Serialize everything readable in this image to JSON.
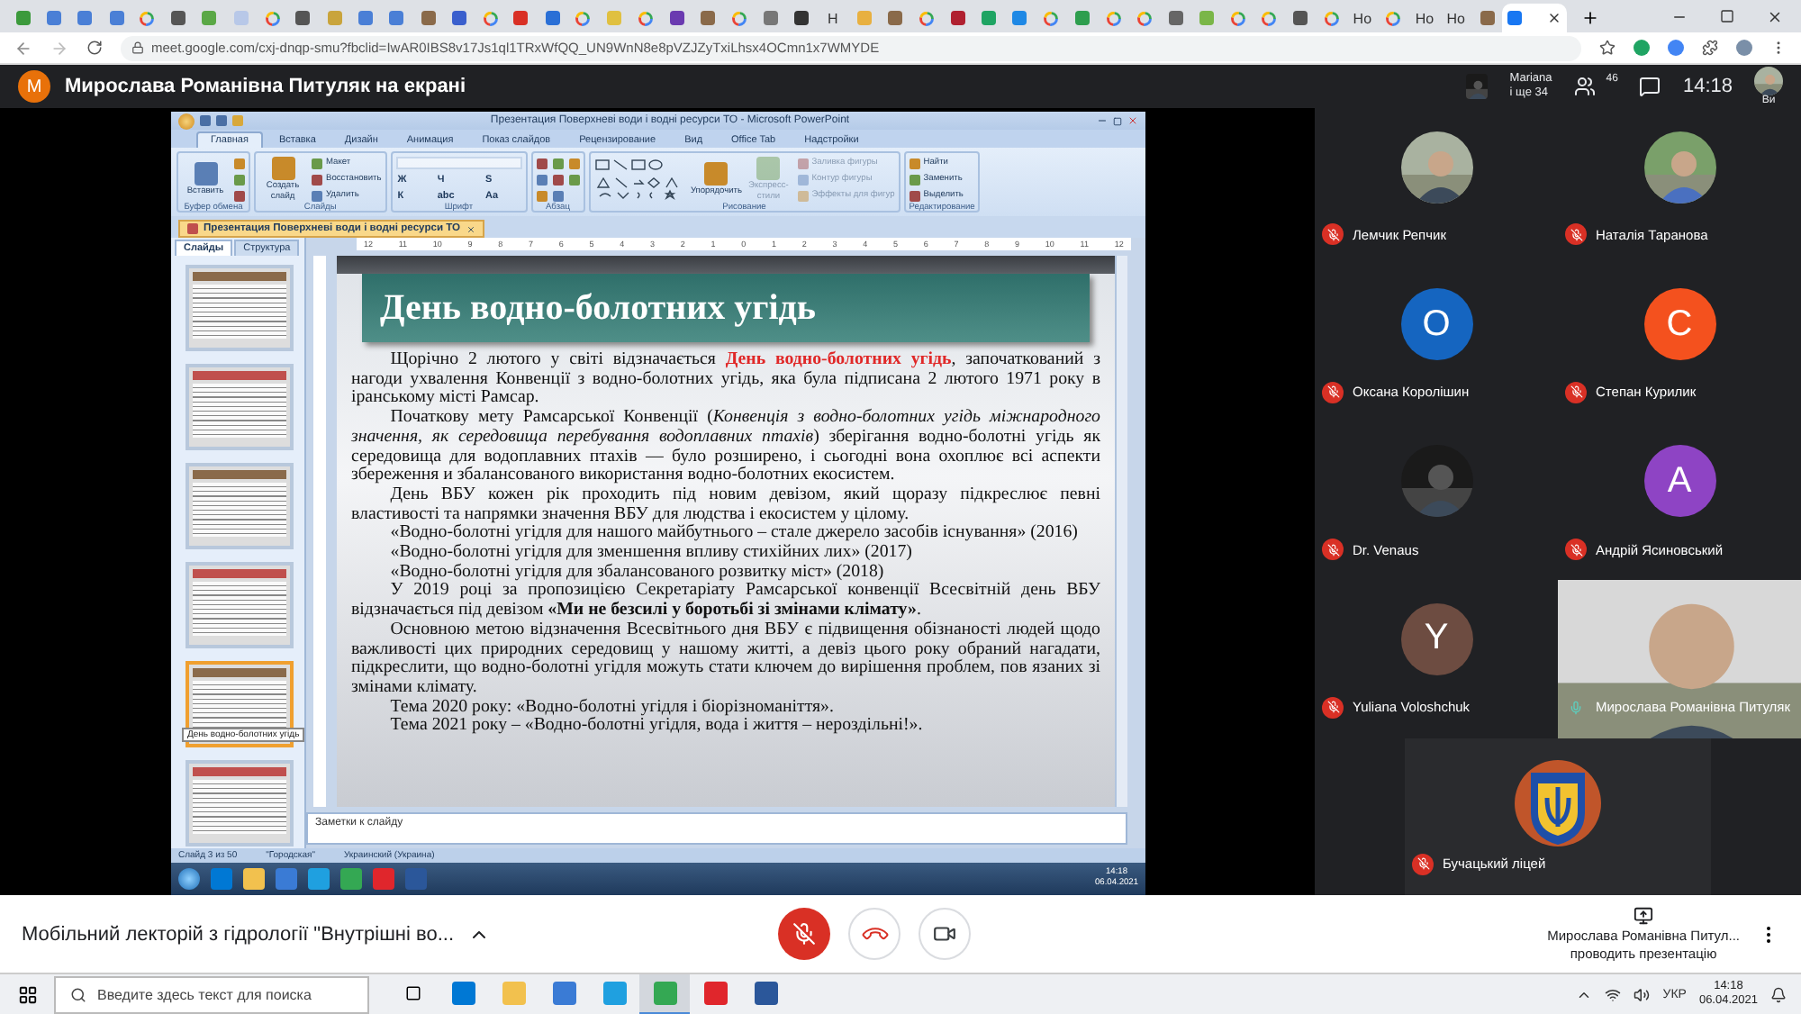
{
  "browser": {
    "tabs": [
      {
        "kind": "favicon",
        "color": "#3c9a3c",
        "selected": false
      },
      {
        "kind": "favicon",
        "color": "#4a7fd6",
        "selected": false
      },
      {
        "kind": "favicon",
        "color": "#4a7fd6",
        "selected": false
      },
      {
        "kind": "favicon",
        "color": "#4a7fd6",
        "selected": false
      },
      {
        "kind": "google",
        "selected": false
      },
      {
        "kind": "favicon",
        "color": "#555555",
        "selected": false
      },
      {
        "kind": "favicon",
        "color": "#5aa846",
        "selected": false
      },
      {
        "kind": "favicon",
        "color": "#b8c8e8",
        "selected": false
      },
      {
        "kind": "google",
        "selected": false
      },
      {
        "kind": "favicon",
        "color": "#555555",
        "selected": false
      },
      {
        "kind": "favicon",
        "color": "#c9a43c",
        "selected": false
      },
      {
        "kind": "favicon",
        "color": "#4a7fd6",
        "selected": false
      },
      {
        "kind": "favicon",
        "color": "#4a7fd6",
        "selected": false
      },
      {
        "kind": "favicon",
        "color": "#8a6a4a",
        "selected": false
      },
      {
        "kind": "favicon",
        "color": "#3a5fcd",
        "selected": false
      },
      {
        "kind": "google",
        "selected": false
      },
      {
        "kind": "favicon",
        "color": "#d93025",
        "selected": false
      },
      {
        "kind": "favicon",
        "color": "#2a6fd6",
        "selected": false
      },
      {
        "kind": "google",
        "selected": false
      },
      {
        "kind": "favicon",
        "color": "#e0c040",
        "selected": false
      },
      {
        "kind": "google",
        "selected": false
      },
      {
        "kind": "favicon",
        "color": "#6a3ab0",
        "selected": false
      },
      {
        "kind": "favicon",
        "color": "#8a6a4a",
        "selected": false
      },
      {
        "kind": "google",
        "selected": false
      },
      {
        "kind": "favicon",
        "color": "#777777",
        "selected": false
      },
      {
        "kind": "favicon",
        "color": "#333333",
        "selected": false
      },
      {
        "kind": "text",
        "label": "H",
        "selected": false
      },
      {
        "kind": "favicon",
        "color": "#e8b040",
        "selected": false
      },
      {
        "kind": "favicon",
        "color": "#8a6a4a",
        "selected": false
      },
      {
        "kind": "google",
        "selected": false
      },
      {
        "kind": "favicon",
        "color": "#b02030",
        "selected": false
      },
      {
        "kind": "favicon",
        "color": "#1fa463",
        "selected": false
      },
      {
        "kind": "favicon",
        "color": "#1e88e5",
        "selected": false
      },
      {
        "kind": "google",
        "selected": false
      },
      {
        "kind": "favicon",
        "color": "#2e9e4e",
        "selected": false
      },
      {
        "kind": "google",
        "selected": false
      },
      {
        "kind": "google",
        "selected": false
      },
      {
        "kind": "favicon",
        "color": "#666666",
        "selected": false
      },
      {
        "kind": "favicon",
        "color": "#7ab648",
        "selected": false
      },
      {
        "kind": "google",
        "selected": false
      },
      {
        "kind": "google",
        "selected": false
      },
      {
        "kind": "favicon",
        "color": "#555555",
        "selected": false
      },
      {
        "kind": "google",
        "selected": false
      },
      {
        "kind": "text",
        "label": "Ho",
        "selected": false
      },
      {
        "kind": "google",
        "selected": false
      },
      {
        "kind": "text",
        "label": "Ho",
        "selected": false
      },
      {
        "kind": "text",
        "label": "Ho",
        "selected": false
      },
      {
        "kind": "favicon",
        "color": "#8a6a4a",
        "selected": false
      },
      {
        "kind": "favicon",
        "color": "#1877f2",
        "selected": true
      }
    ],
    "address": "meet.google.com/cxj-dnqp-smu?fbclid=IwAR0IBS8v17Js1ql1TRxWfQQ_UN9WnN8e8pVZJZyTxiLhsx4OCmn1x7WMYDE"
  },
  "meet": {
    "initial": "M",
    "banner": "Мирослава Романівна Питуляк на екрані",
    "others_name": "Mariana",
    "others_more": "і ще 34",
    "people_count": "46",
    "time": "14:18",
    "self_label": "Ви"
  },
  "presentation": {
    "title": "Презентация Поверхневі води і водні ресурси ТО - Microsoft PowerPoint",
    "ribbon_tabs": [
      {
        "label": "Главная",
        "selected": true
      },
      {
        "label": "Вставка",
        "selected": false
      },
      {
        "label": "Дизайн",
        "selected": false
      },
      {
        "label": "Анимация",
        "selected": false
      },
      {
        "label": "Показ слайдов",
        "selected": false
      },
      {
        "label": "Рецензирование",
        "selected": false
      },
      {
        "label": "Вид",
        "selected": false
      },
      {
        "label": "Office Tab",
        "selected": false
      },
      {
        "label": "Надстройки",
        "selected": false
      }
    ],
    "ribbon_groups": [
      {
        "label": "Буфер обмена",
        "items": [
          {
            "kind": "large",
            "label": "Вставить",
            "disabled": false
          },
          {
            "kind": "icon",
            "disabled": false
          },
          {
            "kind": "icon",
            "disabled": false
          },
          {
            "kind": "icon",
            "disabled": false
          }
        ]
      },
      {
        "label": "Слайды",
        "items": [
          {
            "kind": "large",
            "label": "Создать слайд",
            "disabled": false
          },
          {
            "kind": "small",
            "label": "Макет",
            "disabled": false
          },
          {
            "kind": "small",
            "label": "Восстановить",
            "disabled": false
          },
          {
            "kind": "small",
            "label": "Удалить",
            "disabled": false
          }
        ]
      },
      {
        "label": "Шрифт",
        "items": [
          {
            "kind": "combo",
            "disabled": true
          },
          {
            "kind": "glyph",
            "label": "Ж",
            "disabled": false
          },
          {
            "kind": "glyph",
            "label": "К",
            "disabled": false
          },
          {
            "kind": "glyph",
            "label": "Ч",
            "disabled": false
          },
          {
            "kind": "glyph",
            "label": "abc",
            "disabled": false
          },
          {
            "kind": "glyph",
            "label": "S",
            "disabled": false
          },
          {
            "kind": "glyph",
            "label": "Aa",
            "disabled": false
          }
        ]
      },
      {
        "label": "Абзац",
        "items": [
          {
            "kind": "icon",
            "disabled": false
          },
          {
            "kind": "icon",
            "disabled": false
          },
          {
            "kind": "icon",
            "disabled": false
          },
          {
            "kind": "icon",
            "disabled": false
          },
          {
            "kind": "icon",
            "disabled": false
          },
          {
            "kind": "icon",
            "disabled": false
          },
          {
            "kind": "icon",
            "disabled": false
          },
          {
            "kind": "icon",
            "disabled": false
          }
        ]
      },
      {
        "label": "Рисование",
        "items": [
          {
            "kind": "shapes",
            "disabled": false
          },
          {
            "kind": "large",
            "label": "Упорядочить",
            "disabled": false
          },
          {
            "kind": "large",
            "label": "Экспресс-стили",
            "disabled": true
          },
          {
            "kind": "small",
            "label": "Заливка фигуры",
            "disabled": true
          },
          {
            "kind": "small",
            "label": "Контур фигуры",
            "disabled": true
          },
          {
            "kind": "small",
            "label": "Эффекты для фигур",
            "disabled": true
          }
        ]
      },
      {
        "label": "Редактирование",
        "items": [
          {
            "kind": "small",
            "label": "Найти",
            "disabled": false
          },
          {
            "kind": "small",
            "label": "Заменить",
            "disabled": false
          },
          {
            "kind": "small",
            "label": "Выделить",
            "disabled": false
          }
        ]
      }
    ],
    "document_tab": "Презентация Поверхневі води і водні ресурси ТО",
    "panel_tabs": [
      {
        "label": "Слайды",
        "selected": true
      },
      {
        "label": "Структура",
        "selected": false
      }
    ],
    "thumbnails": [
      {
        "selected": false
      },
      {
        "selected": false
      },
      {
        "selected": false
      },
      {
        "selected": false
      },
      {
        "selected": true
      },
      {
        "selected": false
      }
    ],
    "tooltip": "День водно-болотних угідь",
    "ruler": [
      "12",
      "11",
      "10",
      "9",
      "8",
      "7",
      "6",
      "5",
      "4",
      "3",
      "2",
      "1",
      "0",
      "1",
      "2",
      "3",
      "4",
      "5",
      "6",
      "7",
      "8",
      "9",
      "10",
      "11",
      "12"
    ],
    "slide": {
      "title": "День водно-болотних угідь",
      "paragraphs": [
        {
          "runs": [
            {
              "kind": "plain",
              "text": "Щорічно 2 лютого у світі відзначається "
            },
            {
              "kind": "highlight",
              "text": "День водно-болотних угідь"
            },
            {
              "kind": "plain",
              "text": ", започаткований з нагоди ухвалення Конвенції з водно-болотних угідь, яка була підписана 2 лютого 1971 року в іранському місті Рамсар."
            }
          ]
        },
        {
          "runs": [
            {
              "kind": "plain",
              "text": "Початкову мету Рамсарської Конвенції ("
            },
            {
              "kind": "italic",
              "text": "Конвенція з водно-болотних угідь міжнародного значення, як середовища перебування водоплавних птахів"
            },
            {
              "kind": "plain",
              "text": ") зберігання водно-болотні угідь як середовища для водоплавних птахів — було розширено, і сьогодні вона охоплює всі аспекти збереження и збалансованого використання водно-болотних екосистем."
            }
          ]
        },
        {
          "runs": [
            {
              "kind": "plain",
              "text": "День ВБУ кожен рік проходить під новим девізом, який щоразу підкреслює певні властивості та напрямки значення ВБУ для людства і екосистем у цілому."
            }
          ]
        },
        {
          "runs": [
            {
              "kind": "plain",
              "text": "«Водно-болотні угідля для нашого майбутнього – стале джерело засобів існування» (2016)"
            }
          ]
        },
        {
          "runs": [
            {
              "kind": "plain",
              "text": "«Водно-болотні угідля для зменшення впливу стихійних лих» (2017)"
            }
          ]
        },
        {
          "runs": [
            {
              "kind": "plain",
              "text": "«Водно-болотні угідля для збалансованого розвитку міст» (2018)"
            }
          ]
        },
        {
          "runs": [
            {
              "kind": "plain",
              "text": "У 2019 році за пропозицією Секретаріату Рамсарської конвенції Всесвітній день ВБУ відзначається під девізом "
            },
            {
              "kind": "bold",
              "text": "«Ми не безсилі у боротьбі зі змінами клімату»"
            },
            {
              "kind": "plain",
              "text": "."
            }
          ]
        },
        {
          "runs": [
            {
              "kind": "plain",
              "text": "Основною метою відзначення Всесвітнього дня ВБУ є підвищення обізнаності людей щодо важливості цих природних середовищ у нашому житті, а девіз цього року обраний нагадати, підкреслити, що водно-болотні угідля можуть стати ключем до вирішення проблем, пов язаних зі змінами клімату."
            }
          ]
        },
        {
          "runs": [
            {
              "kind": "plain",
              "text": "Тема  2020 року: «Водно-болотні угідля і біорізноманіття»."
            }
          ]
        },
        {
          "runs": [
            {
              "kind": "plain",
              "text": "Тема 2021 року – «Водно-болотні угідля, вода і життя – нероздільні!»."
            }
          ]
        }
      ]
    },
    "notes_placeholder": "Заметки к слайду",
    "status": [
      "Слайд 3 из 50",
      "\"Городская\"",
      "Украинский (Украина)"
    ],
    "inner_taskbar": {
      "time": "14:18",
      "date": "06.04.2021"
    }
  },
  "participants": [
    {
      "name": "Лемчик Репчик",
      "muted": true
    },
    {
      "name": "Наталія Таранова",
      "muted": true
    },
    {
      "kind": "letter",
      "letter": "O",
      "color": "#1565c0",
      "name": "Оксана Королішин",
      "muted": true
    },
    {
      "kind": "letter",
      "letter": "C",
      "color": "#f4511e",
      "name": "Степан Курилик",
      "muted": true
    },
    {
      "name": "Dr. Venaus",
      "muted": true
    },
    {
      "kind": "letter",
      "letter": "A",
      "color": "#8e44c4",
      "name": "Андрій Ясиновський",
      "muted": true
    },
    {
      "kind": "letter",
      "letter": "Y",
      "color": "#6d4c41",
      "name": "Yuliana Voloshchuk",
      "muted": true
    },
    {
      "kind": "video",
      "name": "Мирослава Романівна Питуляк",
      "muted": false
    },
    {
      "kind": "logo",
      "name": "Бучацький ліцей",
      "muted": true
    }
  ],
  "controls": {
    "meeting_title": "Мобільний лекторій з гідрології \"Внутрішні во...",
    "mic_on": false,
    "presenter_name": "Мирослава Романівна Питул...",
    "presenter_status": "проводить презентацію"
  },
  "taskbar": {
    "search_placeholder": "Введите здесь текст для поиска",
    "apps": [
      {
        "selected": false,
        "color": "#0078d4"
      },
      {
        "selected": false,
        "color": "#f2c14e"
      },
      {
        "selected": false,
        "color": "#3a7bd5"
      },
      {
        "selected": false,
        "color": "#1fa0e0"
      },
      {
        "selected": true,
        "color": "#34a853"
      },
      {
        "selected": false,
        "color": "#e0262c"
      },
      {
        "selected": false,
        "color": "#2b579a"
      }
    ],
    "language": "УКР",
    "time": "14:18",
    "date": "06.04.2021"
  }
}
